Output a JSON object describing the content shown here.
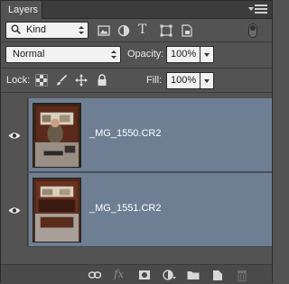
{
  "panel": {
    "tab_label": "Layers",
    "menu_icon": "panel-menu-icon"
  },
  "filter": {
    "kind_label": "Kind",
    "search_icon": "search-icon",
    "filter_icons": [
      "pixel-filter-icon",
      "adjustment-filter-icon",
      "type-filter-icon",
      "shape-filter-icon",
      "smart-object-filter-icon"
    ],
    "type_glyph": "T"
  },
  "blend": {
    "mode": "Normal",
    "opacity_label": "Opacity:",
    "opacity_value": "100%",
    "fill_label": "Fill:",
    "fill_value": "100%"
  },
  "lock": {
    "label": "Lock:",
    "icons": [
      "lock-transparent-pixels-icon",
      "lock-image-pixels-icon",
      "lock-position-icon",
      "lock-all-icon"
    ]
  },
  "layers": [
    {
      "name": "_MG_1550.CR2",
      "visible": true
    },
    {
      "name": "_MG_1551.CR2",
      "visible": true
    }
  ],
  "bottom_toolbar": {
    "icons": [
      "link-layers-icon",
      "layer-style-icon",
      "add-mask-icon",
      "adjustment-layer-icon",
      "new-group-icon",
      "new-layer-icon",
      "delete-layer-icon"
    ],
    "fx_glyph": "fx"
  },
  "colors": {
    "panel_bg": "#535353",
    "selected_layer_bg": "#6f7f93",
    "field_bg": "#f2f2f2"
  }
}
